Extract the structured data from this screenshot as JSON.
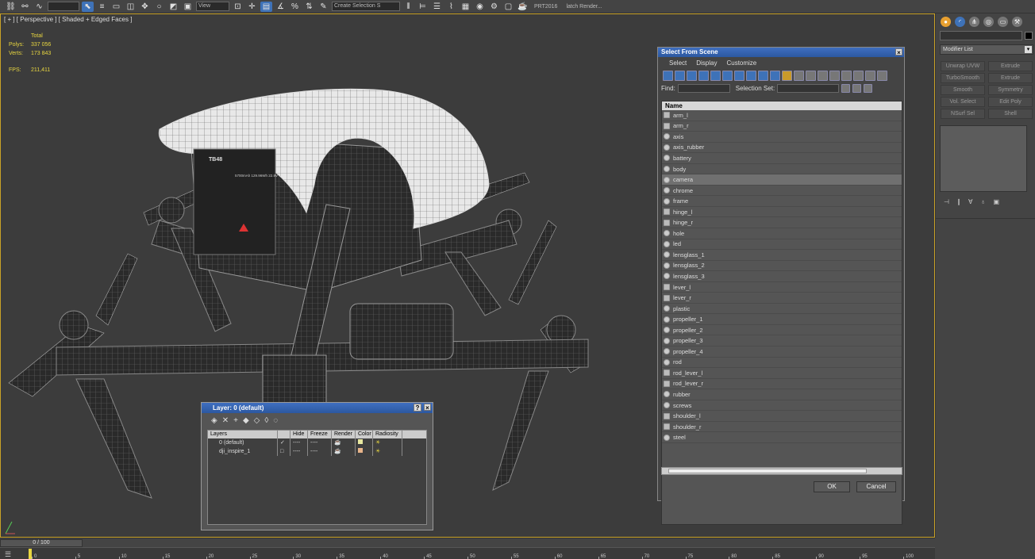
{
  "toolbar": {
    "render_setup_label": "PRT2016",
    "batch_render_label": "latch Render...",
    "selection_set_placeholder": "Create Selection S",
    "view_label": "View",
    "icons": [
      "link-icon",
      "unlink-icon",
      "bind-space-warp-icon",
      "select-object-icon",
      "select-by-name-icon",
      "rect-selection-icon",
      "window-crossing-icon",
      "move-icon",
      "rotate-icon",
      "scale-icon",
      "reference-coord-icon",
      "pivot-icon",
      "select-manipulate-icon",
      "snaps-toggle-icon",
      "angle-snap-icon",
      "percent-snap-icon",
      "spinner-snap-icon",
      "edit-named-sel-icon",
      "mirror-icon",
      "align-icon",
      "layer-explorer-icon",
      "curve-editor-icon",
      "schematic-icon",
      "material-editor-icon",
      "render-setup-icon",
      "rendered-frame-icon",
      "render-icon"
    ]
  },
  "viewport": {
    "label": "[ + ] [ Perspective ] [ Shaded + Edged Faces ]",
    "stats": {
      "header": "Total",
      "polys_label": "Polys:",
      "polys_value": "337 056",
      "verts_label": "Verts:",
      "verts_value": "173 843",
      "fps_label": "FPS:",
      "fps_value": "211,411"
    },
    "battery_label": "TB48",
    "battery_text": "5700mAh 129.96Wh 22.8V"
  },
  "select_from_scene": {
    "title": "Select From Scene",
    "menu": [
      "Select",
      "Display",
      "Customize"
    ],
    "find_label": "Find:",
    "selection_set_label": "Selection Set:",
    "column_header": "Name",
    "items": [
      {
        "name": "arm_l",
        "type": "group"
      },
      {
        "name": "arm_r",
        "type": "group"
      },
      {
        "name": "axis",
        "type": "object"
      },
      {
        "name": "axis_rubber",
        "type": "object"
      },
      {
        "name": "battery",
        "type": "object"
      },
      {
        "name": "body",
        "type": "object"
      },
      {
        "name": "camera",
        "type": "object",
        "selected": true
      },
      {
        "name": "chrome",
        "type": "object"
      },
      {
        "name": "frame",
        "type": "object"
      },
      {
        "name": "hinge_l",
        "type": "group"
      },
      {
        "name": "hinge_r",
        "type": "group"
      },
      {
        "name": "hole",
        "type": "object"
      },
      {
        "name": "led",
        "type": "object"
      },
      {
        "name": "lensglass_1",
        "type": "object"
      },
      {
        "name": "lensglass_2",
        "type": "object"
      },
      {
        "name": "lensglass_3",
        "type": "object"
      },
      {
        "name": "lever_l",
        "type": "group"
      },
      {
        "name": "lever_r",
        "type": "group"
      },
      {
        "name": "plastic",
        "type": "object"
      },
      {
        "name": "propeller_1",
        "type": "object"
      },
      {
        "name": "propeller_2",
        "type": "object"
      },
      {
        "name": "propeller_3",
        "type": "object"
      },
      {
        "name": "propeller_4",
        "type": "object"
      },
      {
        "name": "rod",
        "type": "object"
      },
      {
        "name": "rod_lever_l",
        "type": "group"
      },
      {
        "name": "rod_lever_r",
        "type": "group"
      },
      {
        "name": "rubber",
        "type": "object"
      },
      {
        "name": "screws",
        "type": "object"
      },
      {
        "name": "shoulder_l",
        "type": "group"
      },
      {
        "name": "shoulder_r",
        "type": "group"
      },
      {
        "name": "steel",
        "type": "object"
      }
    ],
    "ok_label": "OK",
    "cancel_label": "Cancel"
  },
  "layer_dialog": {
    "title": "Layer: 0 (default)",
    "help_label": "?",
    "columns": [
      "Layers",
      "",
      "Hide",
      "Freeze",
      "Render",
      "Color",
      "Radiosity"
    ],
    "rows": [
      {
        "name": "0 (default)",
        "current": "✓",
        "hide": "----",
        "freeze": "----",
        "color": "#e8e8a0"
      },
      {
        "name": "dji_inspire_1",
        "current": "□",
        "hide": "----",
        "freeze": "----",
        "color": "#e8b48a"
      }
    ]
  },
  "command_panel": {
    "tabs": [
      "create-tab",
      "modify-tab",
      "hierarchy-tab",
      "motion-tab",
      "display-tab",
      "utilities-tab"
    ],
    "modifier_list_label": "Modifier List",
    "modifiers": [
      "Unwrap UVW",
      "Extrude",
      "TurboSmooth",
      "Extrude",
      "Smooth",
      "Symmetry",
      "Vol. Select",
      "Edit Poly",
      "NSurf Sel",
      "Shell"
    ]
  },
  "timeline": {
    "slider_label": "0 / 100",
    "ticks": [
      "0",
      "5",
      "10",
      "15",
      "20",
      "25",
      "30",
      "35",
      "40",
      "45",
      "50",
      "55",
      "60",
      "65",
      "70",
      "75",
      "80",
      "85",
      "90",
      "95",
      "100"
    ]
  },
  "colors": {
    "accent_blue": "#3e72b8",
    "viewport_border": "#c9a227",
    "stats_yellow": "#e8d640"
  }
}
